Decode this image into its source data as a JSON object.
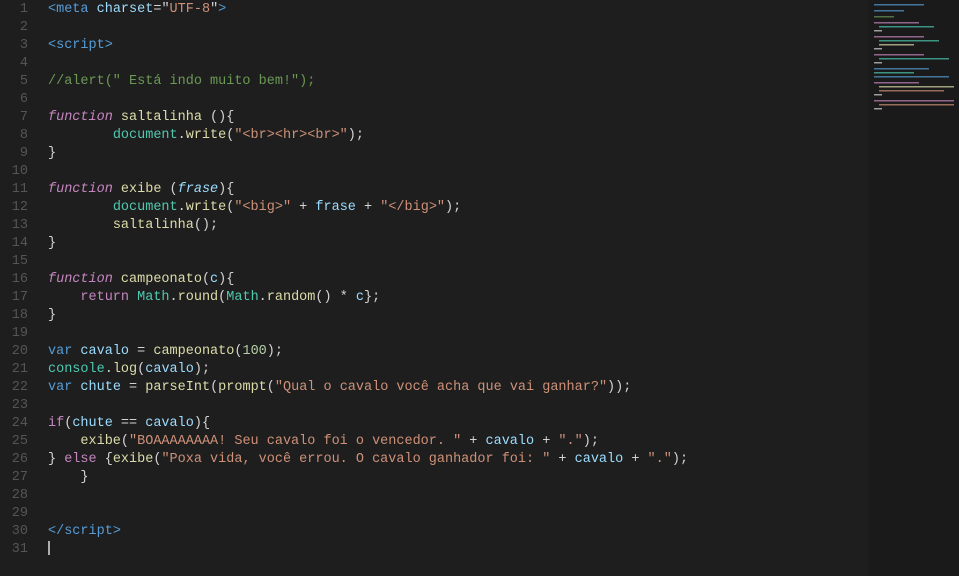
{
  "editor": {
    "lines": [
      {
        "num": 1,
        "tokens": [
          {
            "t": "kw-tag",
            "v": "<meta"
          },
          {
            "t": "punct",
            "v": " "
          },
          {
            "t": "attr",
            "v": "charset"
          },
          {
            "t": "punct",
            "v": "=\""
          },
          {
            "t": "str2",
            "v": "UTF-8"
          },
          {
            "t": "punct",
            "v": "\""
          },
          {
            "t": "kw-tag",
            "v": ">"
          }
        ]
      },
      {
        "num": 2,
        "tokens": []
      },
      {
        "num": 3,
        "tokens": [
          {
            "t": "kw-tag",
            "v": "<script"
          },
          {
            "t": "kw-tag",
            "v": ">"
          }
        ]
      },
      {
        "num": 4,
        "tokens": []
      },
      {
        "num": 5,
        "tokens": [
          {
            "t": "comment",
            "v": "//alert(\" Está indo muito bem!\");"
          }
        ]
      },
      {
        "num": 6,
        "tokens": []
      },
      {
        "num": 7,
        "tokens": [
          {
            "t": "italic-func",
            "v": "function"
          },
          {
            "t": "punct",
            "v": " "
          },
          {
            "t": "fn-name",
            "v": "saltalinha"
          },
          {
            "t": "punct",
            "v": " (){"
          }
        ]
      },
      {
        "num": 8,
        "tokens": [
          {
            "t": "punct",
            "v": "        "
          },
          {
            "t": "obj",
            "v": "document"
          },
          {
            "t": "punct",
            "v": "."
          },
          {
            "t": "fn-name",
            "v": "write"
          },
          {
            "t": "punct",
            "v": "("
          },
          {
            "t": "str",
            "v": "\"<br><hr><br>\""
          },
          {
            "t": "punct",
            "v": ");"
          }
        ]
      },
      {
        "num": 9,
        "tokens": [
          {
            "t": "punct",
            "v": "}"
          }
        ]
      },
      {
        "num": 10,
        "tokens": []
      },
      {
        "num": 11,
        "tokens": [
          {
            "t": "italic-func",
            "v": "function"
          },
          {
            "t": "punct",
            "v": " "
          },
          {
            "t": "fn-name",
            "v": "exibe"
          },
          {
            "t": "punct",
            "v": " ("
          },
          {
            "t": "italic-param",
            "v": "frase"
          },
          {
            "t": "punct",
            "v": "){"
          }
        ]
      },
      {
        "num": 12,
        "tokens": [
          {
            "t": "punct",
            "v": "        "
          },
          {
            "t": "obj",
            "v": "document"
          },
          {
            "t": "punct",
            "v": "."
          },
          {
            "t": "fn-name",
            "v": "write"
          },
          {
            "t": "punct",
            "v": "("
          },
          {
            "t": "str",
            "v": "\"<big>\""
          },
          {
            "t": "punct",
            "v": " + "
          },
          {
            "t": "param",
            "v": "frase"
          },
          {
            "t": "punct",
            "v": " + "
          },
          {
            "t": "str",
            "v": "\"</big>\""
          },
          {
            "t": "punct",
            "v": ");"
          }
        ]
      },
      {
        "num": 13,
        "tokens": [
          {
            "t": "punct",
            "v": "        "
          },
          {
            "t": "fn-name",
            "v": "saltalinha"
          },
          {
            "t": "punct",
            "v": "();"
          }
        ]
      },
      {
        "num": 14,
        "tokens": [
          {
            "t": "punct",
            "v": "}"
          }
        ]
      },
      {
        "num": 15,
        "tokens": []
      },
      {
        "num": 16,
        "tokens": [
          {
            "t": "italic-func",
            "v": "function"
          },
          {
            "t": "punct",
            "v": " "
          },
          {
            "t": "fn-name",
            "v": "campeonato"
          },
          {
            "t": "punct",
            "v": "("
          },
          {
            "t": "param",
            "v": "c"
          },
          {
            "t": "punct",
            "v": "){"
          }
        ]
      },
      {
        "num": 17,
        "tokens": [
          {
            "t": "punct",
            "v": "    "
          },
          {
            "t": "kw-return",
            "v": "return"
          },
          {
            "t": "punct",
            "v": " "
          },
          {
            "t": "obj",
            "v": "Math"
          },
          {
            "t": "punct",
            "v": "."
          },
          {
            "t": "fn-name",
            "v": "round"
          },
          {
            "t": "punct",
            "v": "("
          },
          {
            "t": "obj",
            "v": "Math"
          },
          {
            "t": "punct",
            "v": "."
          },
          {
            "t": "fn-name",
            "v": "random"
          },
          {
            "t": "punct",
            "v": "() * "
          },
          {
            "t": "param",
            "v": "c"
          },
          {
            "t": "punct",
            "v": "};"
          }
        ]
      },
      {
        "num": 18,
        "tokens": [
          {
            "t": "punct",
            "v": "}"
          }
        ]
      },
      {
        "num": 19,
        "tokens": []
      },
      {
        "num": 20,
        "tokens": [
          {
            "t": "kw-var",
            "v": "var"
          },
          {
            "t": "punct",
            "v": " "
          },
          {
            "t": "param",
            "v": "cavalo"
          },
          {
            "t": "punct",
            "v": " = "
          },
          {
            "t": "fn-name",
            "v": "campeonato"
          },
          {
            "t": "punct",
            "v": "("
          },
          {
            "t": "num",
            "v": "100"
          },
          {
            "t": "punct",
            "v": ");"
          }
        ]
      },
      {
        "num": 21,
        "tokens": [
          {
            "t": "obj",
            "v": "console"
          },
          {
            "t": "punct",
            "v": "."
          },
          {
            "t": "fn-name",
            "v": "log"
          },
          {
            "t": "punct",
            "v": "("
          },
          {
            "t": "param",
            "v": "cavalo"
          },
          {
            "t": "punct",
            "v": ");"
          }
        ]
      },
      {
        "num": 22,
        "tokens": [
          {
            "t": "kw-var",
            "v": "var"
          },
          {
            "t": "punct",
            "v": " "
          },
          {
            "t": "param",
            "v": "chute"
          },
          {
            "t": "punct",
            "v": " = "
          },
          {
            "t": "fn-name",
            "v": "parseInt"
          },
          {
            "t": "punct",
            "v": "("
          },
          {
            "t": "fn-name",
            "v": "prompt"
          },
          {
            "t": "punct",
            "v": "("
          },
          {
            "t": "str",
            "v": "\"Qual o cavalo você acha que vai ganhar?\""
          },
          {
            "t": "punct",
            "v": "));"
          }
        ]
      },
      {
        "num": 23,
        "tokens": []
      },
      {
        "num": 24,
        "tokens": [
          {
            "t": "kw-if",
            "v": "if"
          },
          {
            "t": "punct",
            "v": "("
          },
          {
            "t": "param",
            "v": "chute"
          },
          {
            "t": "punct",
            "v": " == "
          },
          {
            "t": "param",
            "v": "cavalo"
          },
          {
            "t": "punct",
            "v": "){"
          }
        ]
      },
      {
        "num": 25,
        "tokens": [
          {
            "t": "punct",
            "v": "    "
          },
          {
            "t": "fn-name",
            "v": "exibe"
          },
          {
            "t": "punct",
            "v": "("
          },
          {
            "t": "str",
            "v": "\"BOAAAAAAAA! Seu cavalo foi o vencedor. \""
          },
          {
            "t": "punct",
            "v": " + "
          },
          {
            "t": "param",
            "v": "cavalo"
          },
          {
            "t": "punct",
            "v": " + "
          },
          {
            "t": "str",
            "v": "\".\""
          },
          {
            "t": "punct",
            "v": ");"
          }
        ]
      },
      {
        "num": 26,
        "tokens": [
          {
            "t": "punct",
            "v": "} "
          },
          {
            "t": "kw-else",
            "v": "else"
          },
          {
            "t": "punct",
            "v": " {"
          },
          {
            "t": "fn-name",
            "v": "exibe"
          },
          {
            "t": "punct",
            "v": "("
          },
          {
            "t": "str",
            "v": "\"Poxa vida, você errou. O cavalo ganhador foi: \""
          },
          {
            "t": "punct",
            "v": " + "
          },
          {
            "t": "param",
            "v": "cavalo"
          },
          {
            "t": "punct",
            "v": " + "
          },
          {
            "t": "str",
            "v": "\".\""
          },
          {
            "t": "punct",
            "v": ");"
          }
        ]
      },
      {
        "num": 27,
        "tokens": [
          {
            "t": "punct",
            "v": "    }"
          }
        ]
      },
      {
        "num": 28,
        "tokens": []
      },
      {
        "num": 29,
        "tokens": []
      },
      {
        "num": 30,
        "tokens": [
          {
            "t": "kw-tag",
            "v": "</script"
          },
          {
            "t": "kw-tag",
            "v": ">"
          }
        ]
      },
      {
        "num": 31,
        "tokens": [],
        "cursor": true
      }
    ]
  },
  "minimap": {
    "visible": true
  }
}
